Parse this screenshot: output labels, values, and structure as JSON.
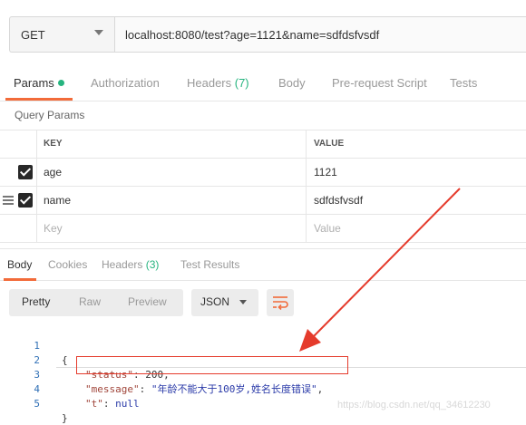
{
  "request": {
    "method": "GET",
    "url": "localhost:8080/test?age=1121&name=sdfdsfvsdf"
  },
  "request_tabs": [
    {
      "label": "Params",
      "active": true,
      "dot": true
    },
    {
      "label": "Authorization"
    },
    {
      "label": "Headers ",
      "count": "(7)"
    },
    {
      "label": "Body"
    },
    {
      "label": "Pre-request Script"
    },
    {
      "label": "Tests"
    }
  ],
  "query_params": {
    "title": "Query Params",
    "columns": {
      "key": "KEY",
      "value": "VALUE"
    },
    "rows": [
      {
        "key": "age",
        "value": "1121",
        "checked": true
      },
      {
        "key": "name",
        "value": "sdfdsfvsdf",
        "checked": true
      }
    ],
    "placeholder": {
      "key": "Key",
      "value": "Value"
    }
  },
  "response_tabs": [
    {
      "label": "Body",
      "active": true
    },
    {
      "label": "Cookies"
    },
    {
      "label": "Headers ",
      "count": "(3)"
    },
    {
      "label": "Test Results"
    }
  ],
  "body_toolbar": {
    "views": [
      "Pretty",
      "Raw",
      "Preview"
    ],
    "active_view": "Pretty",
    "format": "JSON"
  },
  "response_body": {
    "line_numbers": [
      "1",
      "2",
      "3",
      "4",
      "5"
    ],
    "lines": {
      "l1_open": "{",
      "l2_key": "\"status\"",
      "l2_sep": ": ",
      "l2_val": "200",
      "l2_end": ",",
      "l3_key": "\"message\"",
      "l3_sep": ": ",
      "l3_val": "\"年龄不能大于100岁,姓名长度错误\"",
      "l3_end": ",",
      "l4_key": "\"t\"",
      "l4_sep": ": ",
      "l4_val": "null",
      "l5_close": "}"
    }
  },
  "annotation": {
    "color": "#e53b2c"
  },
  "watermark": "https://blog.csdn.net/qq_34612230",
  "colors": {
    "accent": "#f26b3a",
    "green": "#26b47f"
  }
}
